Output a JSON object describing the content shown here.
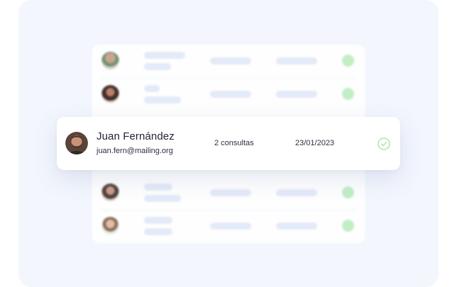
{
  "colors": {
    "backdrop": "#f3f6fd",
    "placeholder_bar": "#e3eaf8",
    "status_green": "#bfeec3",
    "check_green": "#9ee0a6",
    "text_primary": "#1f2430"
  },
  "featured_patient": {
    "name": "Juan Fernández",
    "email": "juan.fern@mailing.org",
    "consultations": "2 consultas",
    "date": "23/01/2023",
    "status_icon": "check-circle-icon"
  }
}
